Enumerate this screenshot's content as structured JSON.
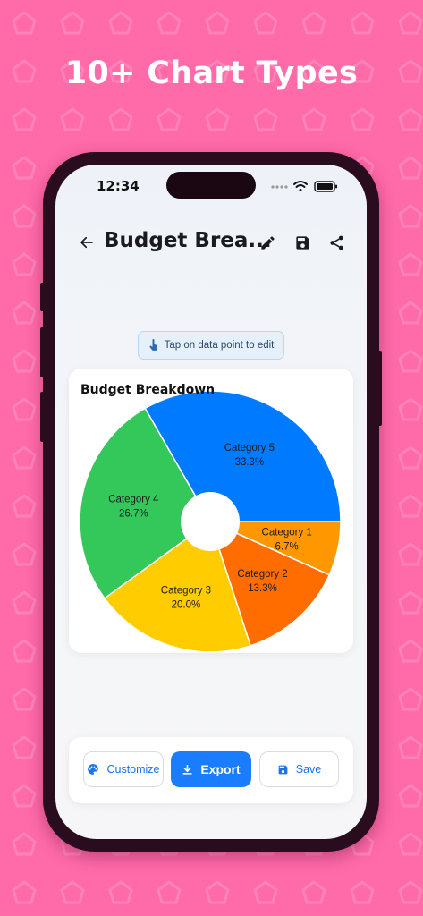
{
  "headline": "10+ Chart Types",
  "status_bar": {
    "time": "12:34"
  },
  "app_bar": {
    "title": "Budget Brea...",
    "back_icon": "arrow-back-icon",
    "edit_icon": "pencil-icon",
    "save_icon": "floppy-disk-icon",
    "share_icon": "share-icon"
  },
  "hint": {
    "text": "Tap on data point to edit",
    "icon": "touch-hand-icon"
  },
  "chart_data": {
    "type": "pie",
    "title": "Budget Breakdown",
    "donut": true,
    "slices": [
      {
        "label": "Category 1",
        "value": 6.7,
        "display": "6.7%",
        "color": "#ff9800"
      },
      {
        "label": "Category 2",
        "value": 13.3,
        "display": "13.3%",
        "color": "#ff6d00"
      },
      {
        "label": "Category 3",
        "value": 20.0,
        "display": "20.0%",
        "color": "#ffcc00"
      },
      {
        "label": "Category 4",
        "value": 26.7,
        "display": "26.7%",
        "color": "#34c759"
      },
      {
        "label": "Category 5",
        "value": 33.3,
        "display": "33.3%",
        "color": "#007aff"
      }
    ]
  },
  "actions": {
    "customize": {
      "label": "Customize",
      "icon": "palette-icon"
    },
    "export": {
      "label": "Export",
      "icon": "download-icon"
    },
    "save": {
      "label": "Save",
      "icon": "floppy-disk-icon"
    }
  },
  "colors": {
    "background": "#ff6aa8",
    "accent": "#1a7dff",
    "phone_frame": "#2a0c1f"
  }
}
